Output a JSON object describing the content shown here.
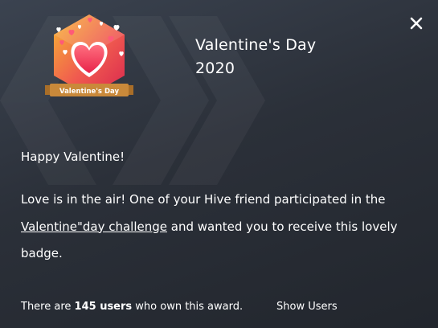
{
  "badge": {
    "title_line1": "Valentine's Day",
    "title_line2": "2020",
    "ribbon_text": "Valentine's Day"
  },
  "close": {
    "icon": "close-icon"
  },
  "body": {
    "greeting": "Happy Valentine!",
    "message_part1": "Love is in the air! One of your Hive friend participated in the ",
    "challenge_link": "Valentine\"day challenge",
    "message_part2": " and wanted you to receive this lovely badge."
  },
  "footer": {
    "prefix": "There are ",
    "count": "145 users",
    "suffix": " who own this award.",
    "show_users_label": "Show Users"
  },
  "colors": {
    "background": "#2b3039",
    "text": "#ffffff",
    "ribbon": "#c9893a",
    "badge_orange": "#f5a623",
    "badge_red": "#e8315a",
    "heart": "#ff4d6d"
  }
}
